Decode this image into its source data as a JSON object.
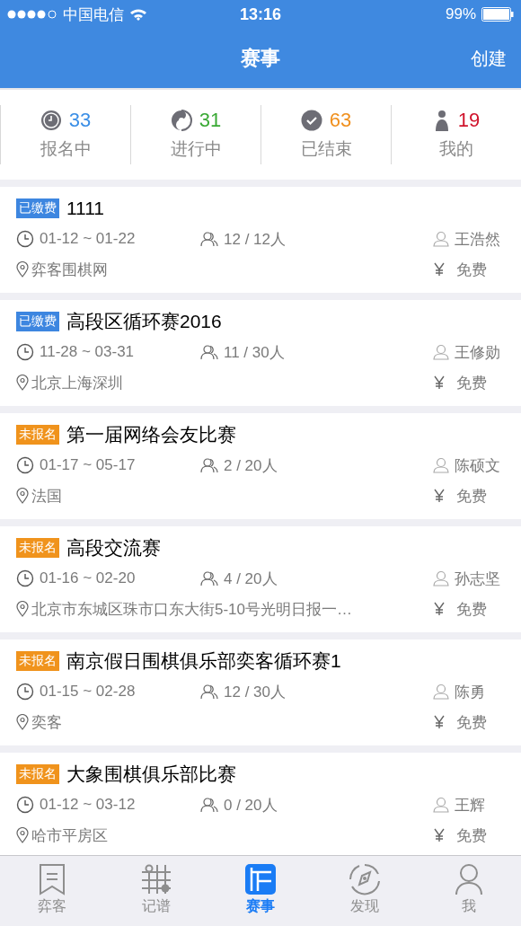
{
  "status_bar": {
    "carrier": "中国电信",
    "time": "13:16",
    "battery": "99%"
  },
  "nav_bar": {
    "title": "赛事",
    "action": "创建"
  },
  "stats": [
    {
      "kind": "clock",
      "count": "33",
      "label": "报名中",
      "color": "#3a8ee6"
    },
    {
      "kind": "swirl",
      "count": "31",
      "label": "进行中",
      "color": "#3aa935"
    },
    {
      "kind": "check",
      "count": "63",
      "label": "已结束",
      "color": "#f0901e"
    },
    {
      "kind": "person",
      "count": "19",
      "label": "我的",
      "color": "#d0142c"
    }
  ],
  "events": [
    {
      "badge": {
        "text": "已缴费",
        "color": "#3d86e0"
      },
      "title": "1111",
      "dates": "01-12 ~ 01-22",
      "people": "12 / 12人",
      "organizer": "王浩然",
      "location": "弈客围棋网",
      "fee": "免费"
    },
    {
      "badge": {
        "text": "已缴费",
        "color": "#3d86e0"
      },
      "title": "高段区循环赛2016",
      "dates": "11-28 ~ 03-31",
      "people": "11 / 30人",
      "organizer": "王修勋",
      "location": "北京上海深圳",
      "fee": "免费"
    },
    {
      "badge": {
        "text": "未报名",
        "color": "#f0931c"
      },
      "title": "第一届网络会友比赛",
      "dates": "01-17 ~ 05-17",
      "people": "2 / 20人",
      "organizer": "陈硕文",
      "location": "法国",
      "fee": "免费"
    },
    {
      "badge": {
        "text": "未报名",
        "color": "#f0931c"
      },
      "title": "高段交流赛",
      "dates": "01-16 ~ 02-20",
      "people": "4 / 20人",
      "organizer": "孙志坚",
      "location": "北京市东城区珠市口东大街5-10号光明日报一…",
      "fee": "免费"
    },
    {
      "badge": {
        "text": "未报名",
        "color": "#f0931c"
      },
      "title": "南京假日围棋俱乐部奕客循环赛1",
      "dates": "01-15 ~ 02-28",
      "people": "12 / 30人",
      "organizer": "陈勇",
      "location": "奕客",
      "fee": "免费"
    },
    {
      "badge": {
        "text": "未报名",
        "color": "#f0931c"
      },
      "title": "大象围棋俱乐部比赛",
      "dates": "01-12 ~ 03-12",
      "people": "0 / 20人",
      "organizer": "王辉",
      "location": "哈市平房区",
      "fee": "免费"
    }
  ],
  "tab_bar": [
    {
      "kind": "bookmark",
      "label": "弈客",
      "selected": false
    },
    {
      "kind": "grid",
      "label": "记谱",
      "selected": false
    },
    {
      "kind": "board",
      "label": "赛事",
      "selected": true
    },
    {
      "kind": "compass",
      "label": "发现",
      "selected": false
    },
    {
      "kind": "user",
      "label": "我",
      "selected": false
    }
  ]
}
